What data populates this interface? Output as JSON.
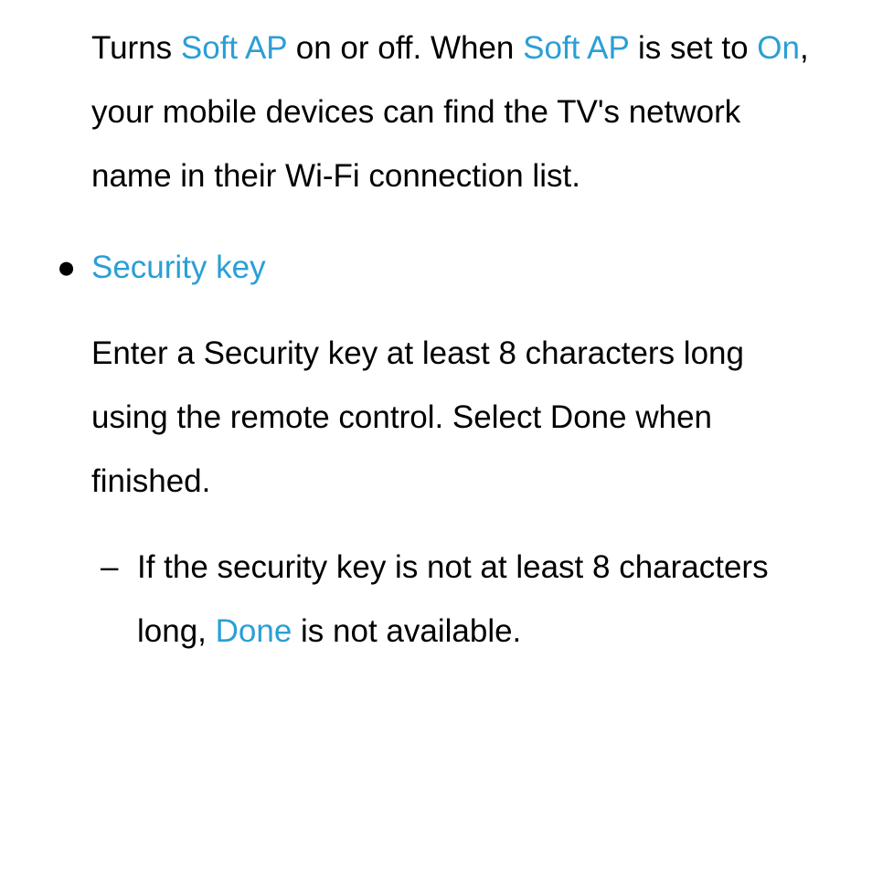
{
  "para1": {
    "t1": "Turns ",
    "h1": "Soft AP",
    "t2": " on or off. When ",
    "h2": "Soft AP",
    "t3": " is set to ",
    "h3": "On",
    "t4": ", your mobile devices can find the TV's network name in their Wi-Fi connection list."
  },
  "bullet": {
    "marker": "●",
    "label": "Security key"
  },
  "para2": "Enter a Security key at least 8 characters long using the remote control. Select Done when finished.",
  "dash": {
    "marker": "–",
    "t1": "If the security key is not at least 8 characters long, ",
    "h1": "Done",
    "t2": " is not available."
  }
}
